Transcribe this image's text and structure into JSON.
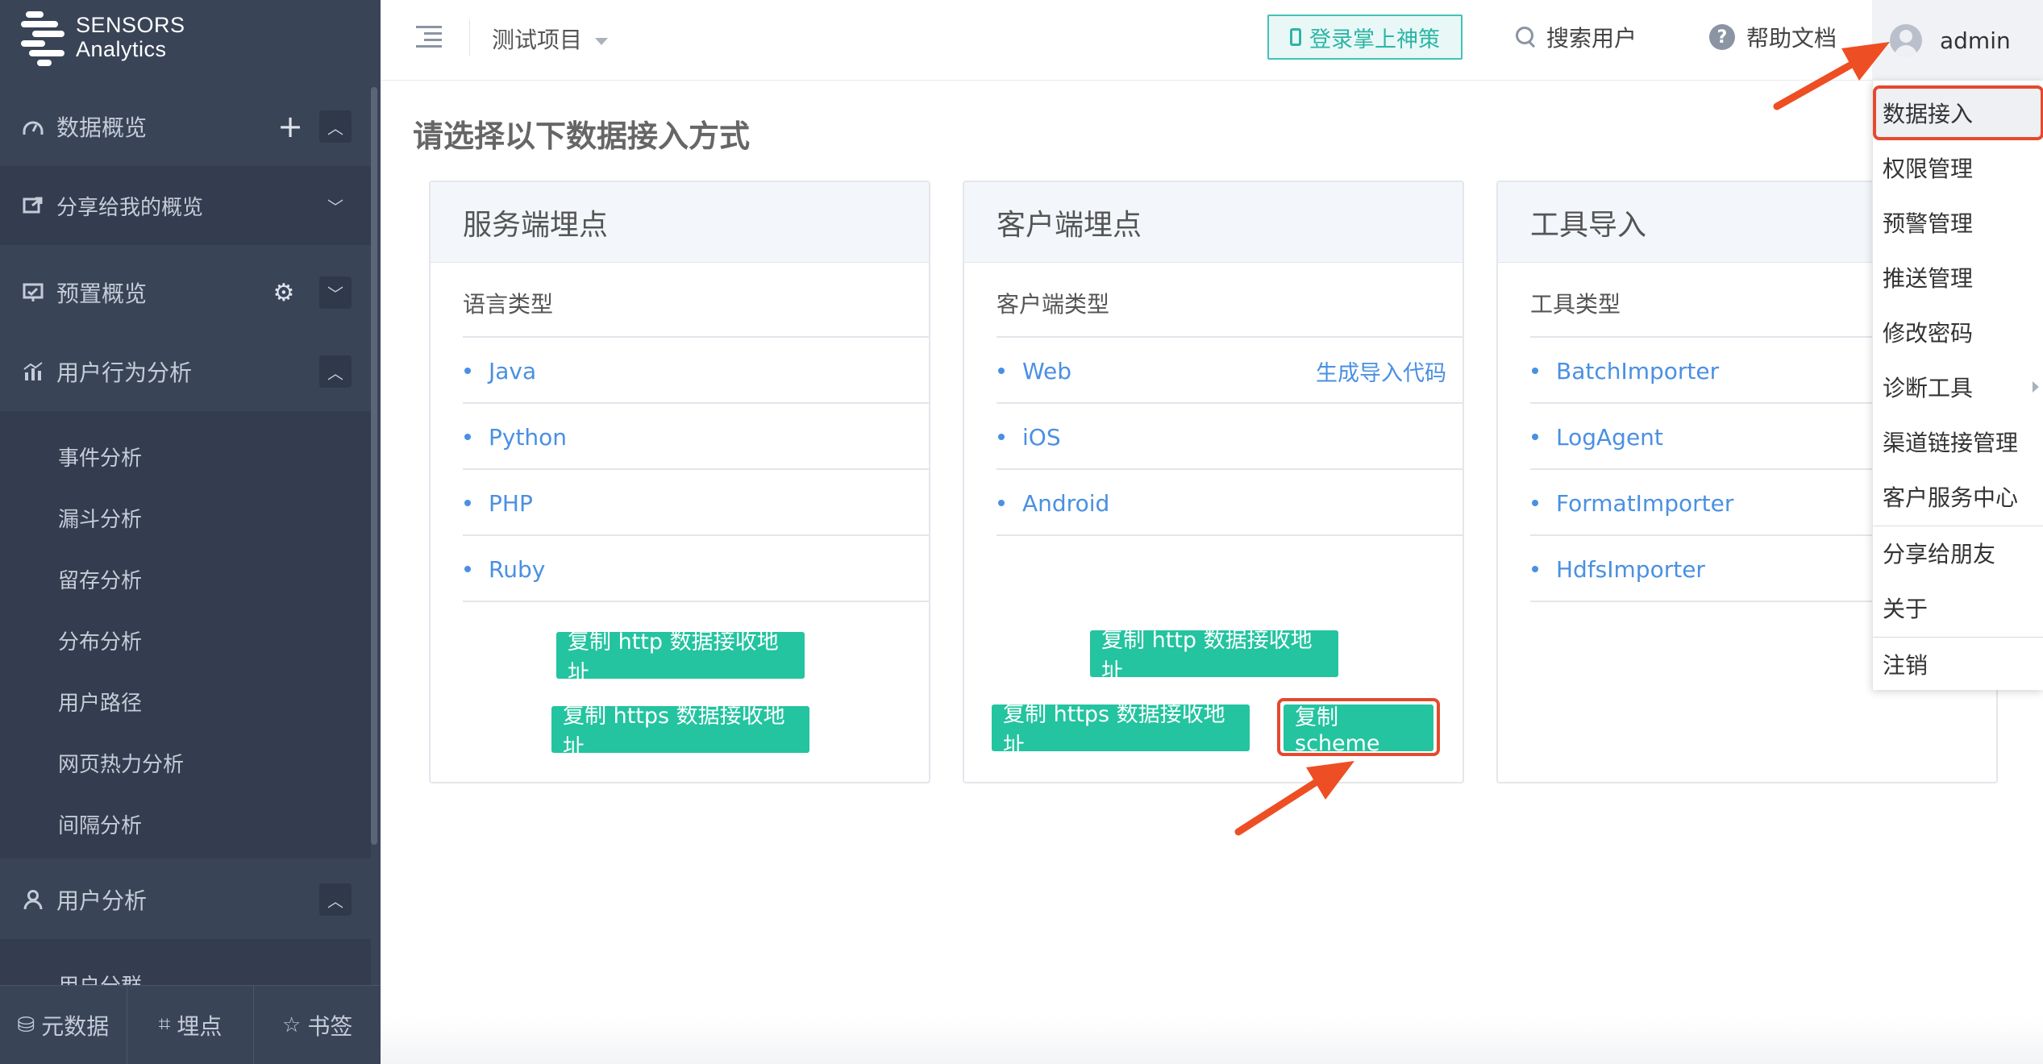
{
  "app": {
    "logo_line1": "SENSORS",
    "logo_line2": "Analytics"
  },
  "sidebar": {
    "overview": "数据概览",
    "shared_overview": "分享给我的概览",
    "preset_overview": "预置概览",
    "behavior_analysis": "用户行为分析",
    "behavior_items": [
      "事件分析",
      "漏斗分析",
      "留存分析",
      "分布分析",
      "用户路径",
      "网页热力分析",
      "间隔分析"
    ],
    "user_analysis": "用户分析",
    "user_items": [
      "用户分群"
    ],
    "bottom": [
      "元数据",
      "埋点",
      "书签"
    ]
  },
  "topbar": {
    "project": "测试项目",
    "login_mobile": "登录掌上神策",
    "search_user": "搜索用户",
    "help_docs": "帮助文档",
    "username": "admin"
  },
  "main": {
    "title": "请选择以下数据接入方式",
    "cards": [
      {
        "title": "服务端埋点",
        "subtitle": "语言类型",
        "items": [
          "Java",
          "Python",
          "PHP",
          "Ruby"
        ],
        "buttons": [
          "复制 http 数据接收地址",
          "复制 https 数据接收地址"
        ]
      },
      {
        "title": "客户端埋点",
        "subtitle": "客户端类型",
        "items": [
          "Web",
          "iOS",
          "Android"
        ],
        "web_extra": "生成导入代码",
        "buttons": [
          "复制 http 数据接收地址",
          "复制 https 数据接收地址",
          "复制 scheme"
        ]
      },
      {
        "title": "工具导入",
        "subtitle": "工具类型",
        "items": [
          "BatchImporter",
          "LogAgent",
          "FormatImporter",
          "HdfsImporter"
        ]
      }
    ]
  },
  "dropdown": {
    "items": [
      "数据接入",
      "权限管理",
      "预警管理",
      "推送管理",
      "修改密码",
      "诊断工具",
      "渠道链接管理",
      "客户服务中心",
      "分享给朋友",
      "关于",
      "注销"
    ]
  },
  "colors": {
    "sidebar_bg": "#394457",
    "accent_green": "#23c49f",
    "link_blue": "#4a90e2",
    "highlight_red": "#e44a2e",
    "mobile_btn": "#2cb5a6"
  }
}
